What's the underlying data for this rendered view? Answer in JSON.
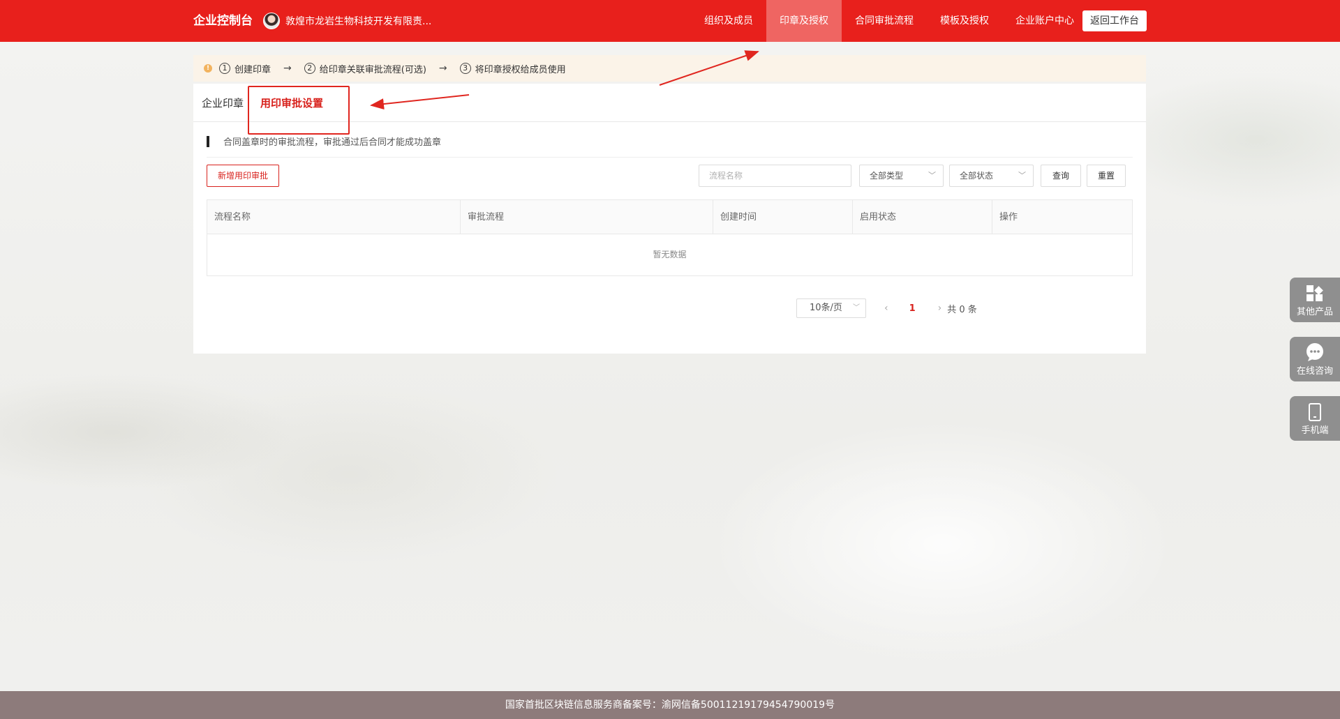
{
  "header": {
    "brand": "企业控制台",
    "org_name": "敦煌市龙岩生物科技开发有限责...",
    "nav": [
      {
        "label": "组织及成员"
      },
      {
        "label": "印章及授权"
      },
      {
        "label": "合同审批流程"
      },
      {
        "label": "模板及授权"
      },
      {
        "label": "企业账户中心"
      }
    ],
    "active_nav": "印章及授权",
    "back_button": "返回工作台",
    "colors": {
      "bar": "#e8201c",
      "active": "#ef6562"
    }
  },
  "steps": {
    "items": [
      {
        "num": "1",
        "label": "创建印章"
      },
      {
        "num": "2",
        "label": "给印章关联审批流程(可选)"
      },
      {
        "num": "3",
        "label": "将印章授权给成员使用"
      }
    ],
    "arrow": "→"
  },
  "tabs": {
    "seal": "企业印章",
    "approval": "用印审批设置"
  },
  "description": "合同盖章时的审批流程，审批通过后合同才能成功盖章",
  "toolbar": {
    "add_button": "新增用印审批",
    "search_placeholder": "流程名称",
    "type_select": "全部类型",
    "status_select": "全部状态",
    "query_button": "查询",
    "reset_button": "重置"
  },
  "table": {
    "columns": [
      "流程名称",
      "审批流程",
      "创建时间",
      "启用状态",
      "操作"
    ],
    "rows": [],
    "empty_text": "暂无数据"
  },
  "pagination": {
    "page_size": "10条/页",
    "prev": "‹",
    "current_page": "1",
    "next": "›",
    "total": "共 0 条"
  },
  "float_panel": [
    {
      "label": "其他产品",
      "icon": "grid-icon"
    },
    {
      "label": "在线咨询",
      "icon": "chat-icon"
    },
    {
      "label": "手机端",
      "icon": "phone-icon"
    }
  ],
  "footer": "国家首批区块链信息服务商备案号：渝网信备50011219179454790019号"
}
